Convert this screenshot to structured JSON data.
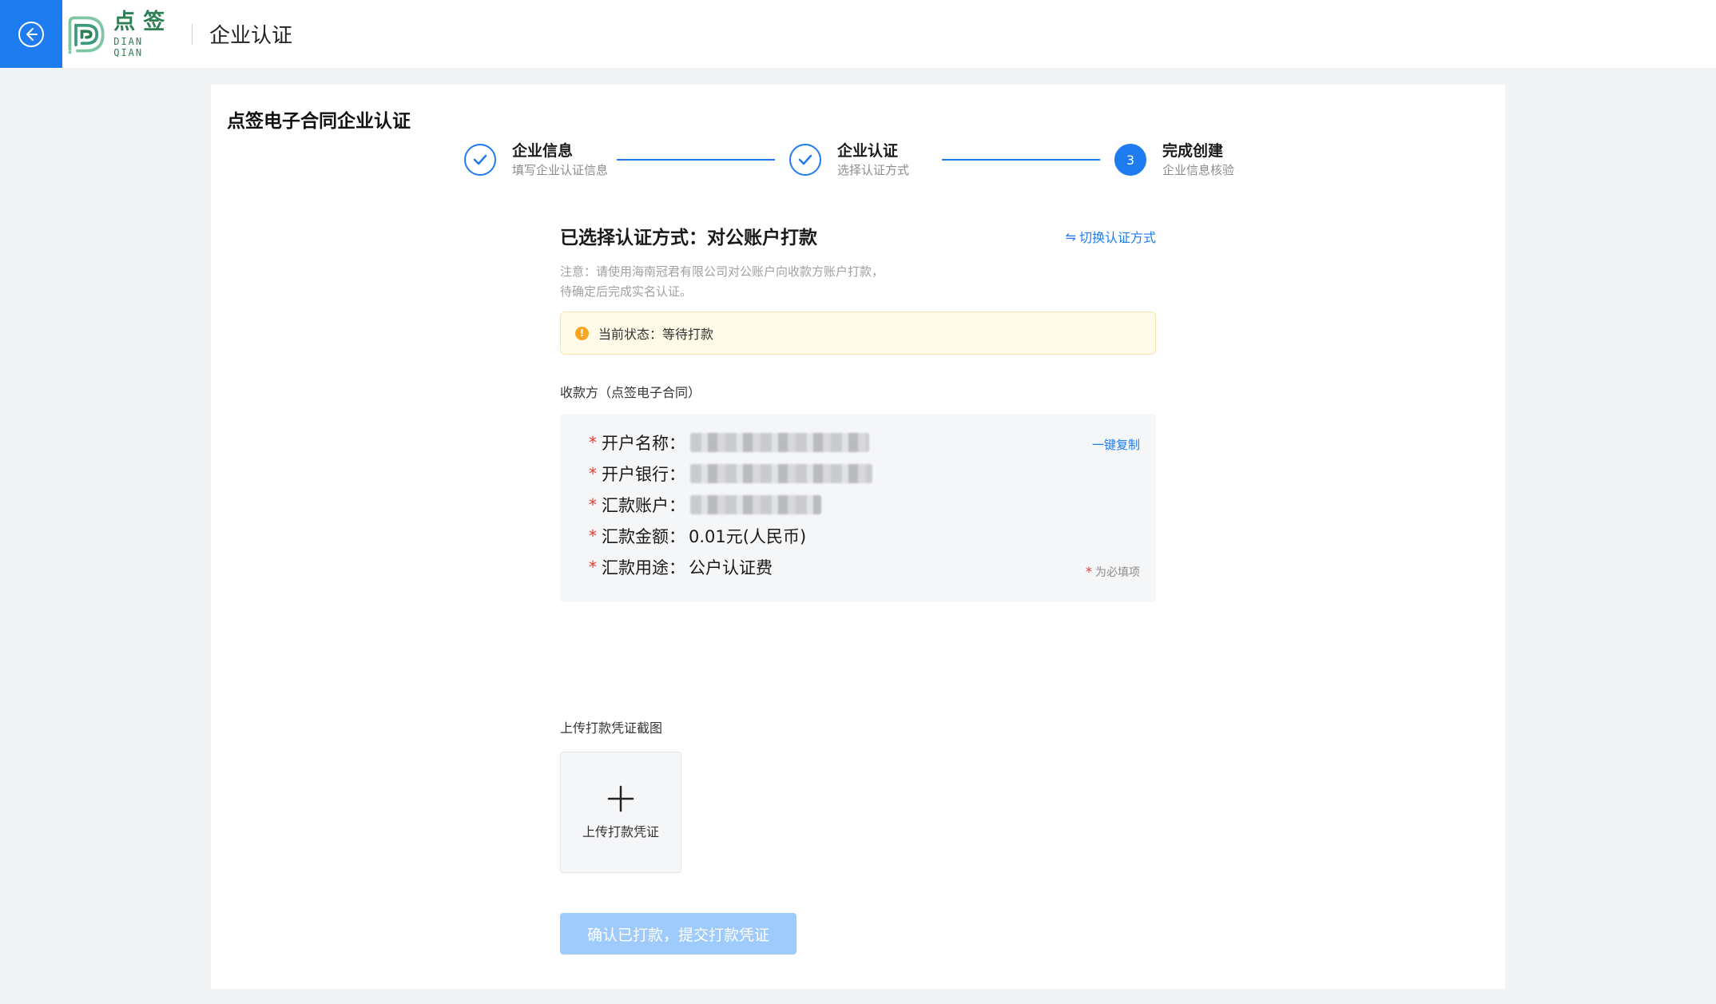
{
  "header": {
    "logo_cn": "点签",
    "logo_en": "DIAN QIAN",
    "title": "企业认证"
  },
  "card": {
    "title": "点签电子合同企业认证"
  },
  "steps": [
    {
      "title": "企业信息",
      "sub": "填写企业认证信息",
      "status": "done"
    },
    {
      "title": "企业认证",
      "sub": "选择认证方式",
      "status": "done"
    },
    {
      "title": "完成创建",
      "sub": "企业信息核验",
      "status": "active",
      "number": "3"
    }
  ],
  "method": {
    "title": "已选择认证方式：对公账户打款",
    "switch_label": "切换认证方式",
    "notice_line1": "注意：请使用海南冠君有限公司对公账户向收款方账户打款，",
    "notice_line2": "待确定后完成实名认证。"
  },
  "status": {
    "text": "当前状态：等待打款",
    "icon": "!"
  },
  "payee": {
    "label": "收款方（点签电子合同）",
    "copy_label": "一键复制",
    "required_hint": "为必填项",
    "rows": [
      {
        "label": "开户名称：",
        "value": ""
      },
      {
        "label": "开户银行：",
        "value": ""
      },
      {
        "label": "汇款账户：",
        "value": ""
      },
      {
        "label": "汇款金额：",
        "value": "0.01元(人民币)"
      },
      {
        "label": "汇款用途：",
        "value": "公户认证费"
      }
    ]
  },
  "upload": {
    "label": "上传打款凭证截图",
    "button_text": "上传打款凭证"
  },
  "submit": {
    "label": "确认已打款，提交打款凭证"
  },
  "colors": {
    "primary": "#1f7cf0",
    "brand_green": "#2f7f56",
    "warning": "#f5a623",
    "required": "#e53935",
    "disabled_button": "#9ecbfb"
  }
}
